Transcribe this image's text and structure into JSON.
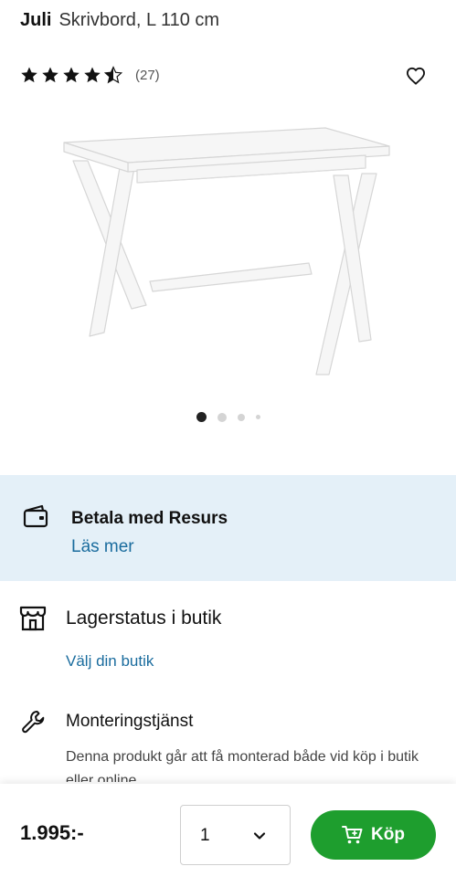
{
  "product": {
    "brand": "Juli",
    "name": "Skrivbord, L 110 cm",
    "rating": 4.5,
    "rating_max": 5,
    "review_count": "(27)"
  },
  "gallery": {
    "image_count": 4,
    "active_index": 0
  },
  "resurs": {
    "title": "Betala med Resurs",
    "link": "Läs mer"
  },
  "stock": {
    "title": "Lagerstatus i butik",
    "link": "Välj din butik"
  },
  "mounting": {
    "title": "Monteringstjänst",
    "description": "Denna produkt går att få monterad både vid köp i butik eller online"
  },
  "footer": {
    "price": "1.995:-",
    "quantity": "1",
    "buy_label": "Köp"
  },
  "icons": {
    "favorite": "heart-icon",
    "resurs": "wallet-icon",
    "stock": "store-icon",
    "mounting": "wrench-icon",
    "quantity": "chevron-down-icon",
    "buy": "cart-icon"
  },
  "colors": {
    "buy_button": "#1e9e2e",
    "link": "#1a6c9e",
    "banner_bg": "#e4f0f8"
  }
}
